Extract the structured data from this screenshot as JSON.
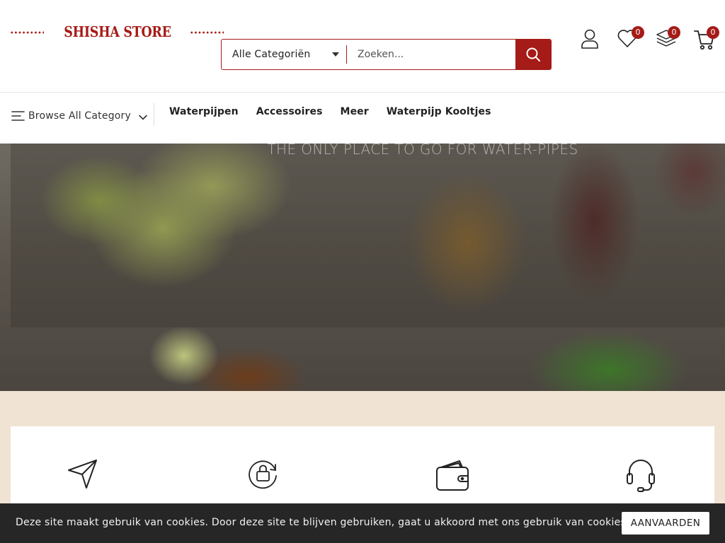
{
  "header": {
    "logo_text": "SHISHA STORE",
    "search": {
      "category_label": "Alle Categoriën",
      "placeholder": "Zoeken..."
    },
    "icons": {
      "account": "user-icon",
      "wishlist": "heart-icon",
      "compare": "layers-icon",
      "cart": "cart-icon"
    },
    "wishlist_count": "0",
    "compare_count": "0",
    "cart_count": "0"
  },
  "nav": {
    "browse_label": "Browse All Category",
    "links": [
      "Waterpijpen",
      "Accessoires",
      "Meer",
      "Waterpijp Kooltjes"
    ]
  },
  "hero": {
    "tagline": "THE ONLY PLACE TO GO FOR WATER-PIPES"
  },
  "features": {
    "icons": [
      "send-icon",
      "refresh-bag-icon",
      "wallet-icon",
      "headset-icon"
    ]
  },
  "cookie_bar": {
    "message": "Deze site maakt gebruik van cookies. Door deze site te blijven gebruiken, gaat u akkoord met ons gebruik van cookies.",
    "accept_label": "AANVAARDEN"
  },
  "colors": {
    "brand": "#a51b17",
    "feature_band": "#f0e3d3",
    "cookie_bg": "#262626"
  }
}
